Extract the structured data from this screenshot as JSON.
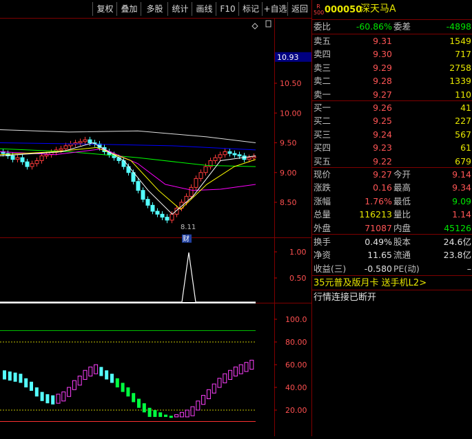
{
  "toolbar": {
    "buttons": [
      "复权",
      "叠加",
      "多股",
      "统计",
      "画线",
      "F10",
      "标记",
      "+自选",
      "返回"
    ]
  },
  "stock": {
    "badge_top": "R",
    "badge_bottom": "500",
    "code": "000050",
    "name": "深天马A"
  },
  "weibi": {
    "label1": "委比",
    "value1": "-60.86%",
    "label2": "委差",
    "value2": "-4898"
  },
  "asks": [
    {
      "label": "卖五",
      "price": "9.31",
      "vol": "1549"
    },
    {
      "label": "卖四",
      "price": "9.30",
      "vol": "717"
    },
    {
      "label": "卖三",
      "price": "9.29",
      "vol": "2758"
    },
    {
      "label": "卖二",
      "price": "9.28",
      "vol": "1339"
    },
    {
      "label": "卖一",
      "price": "9.27",
      "vol": "110"
    }
  ],
  "bids": [
    {
      "label": "买一",
      "price": "9.26",
      "vol": "41"
    },
    {
      "label": "买二",
      "price": "9.25",
      "vol": "227"
    },
    {
      "label": "买三",
      "price": "9.24",
      "vol": "567"
    },
    {
      "label": "买四",
      "price": "9.23",
      "vol": "61"
    },
    {
      "label": "买五",
      "price": "9.22",
      "vol": "679"
    }
  ],
  "quote": [
    {
      "l1": "现价",
      "v1": "9.27",
      "c1": "red",
      "l2": "今开",
      "v2": "9.14",
      "c2": "red"
    },
    {
      "l1": "涨跌",
      "v1": "0.16",
      "c1": "red",
      "l2": "最高",
      "v2": "9.34",
      "c2": "red"
    },
    {
      "l1": "涨幅",
      "v1": "1.76%",
      "c1": "red",
      "l2": "最低",
      "v2": "9.09",
      "c2": "green"
    },
    {
      "l1": "总量",
      "v1": "116213",
      "c1": "yellow",
      "l2": "量比",
      "v2": "1.14",
      "c2": "red"
    },
    {
      "l1": "外盘",
      "v1": "71087",
      "c1": "red",
      "l2": "内盘",
      "v2": "45126",
      "c2": "green"
    }
  ],
  "fundamentals": [
    {
      "l1": "换手",
      "v1": "0.49%",
      "l2": "股本",
      "v2": "24.6亿"
    },
    {
      "l1": "净资",
      "v1": "11.65",
      "l2": "流通",
      "v2": "23.8亿"
    },
    {
      "l1": "收益(三)",
      "v1": "-0.580",
      "l2": "PE(动)",
      "v2": "–"
    }
  ],
  "promo": "35元普及版月卡 送手机L2>",
  "status": "行情连接已断开",
  "price_axis": {
    "current": "10.93",
    "ticks": [
      "10.50",
      "10.00",
      "9.50",
      "9.00",
      "8.50"
    ]
  },
  "mid_axis": {
    "ticks": [
      "1.00",
      "0.50"
    ]
  },
  "low_axis": {
    "ticks": [
      "100.0",
      "80.00",
      "60.00",
      "40.00",
      "20.00"
    ]
  },
  "annotations": {
    "low_mark": "8.11",
    "finance_tag": "财"
  },
  "colors": {
    "up": "#ff3c3c",
    "down": "#54ffff",
    "ma1": "#ffffff",
    "ma2": "#ffff00",
    "ma3": "#ff00ff",
    "ma4": "#00ff00",
    "ma5": "#0000ff",
    "ma6": "#e0e0e0",
    "border": "#800000"
  }
}
